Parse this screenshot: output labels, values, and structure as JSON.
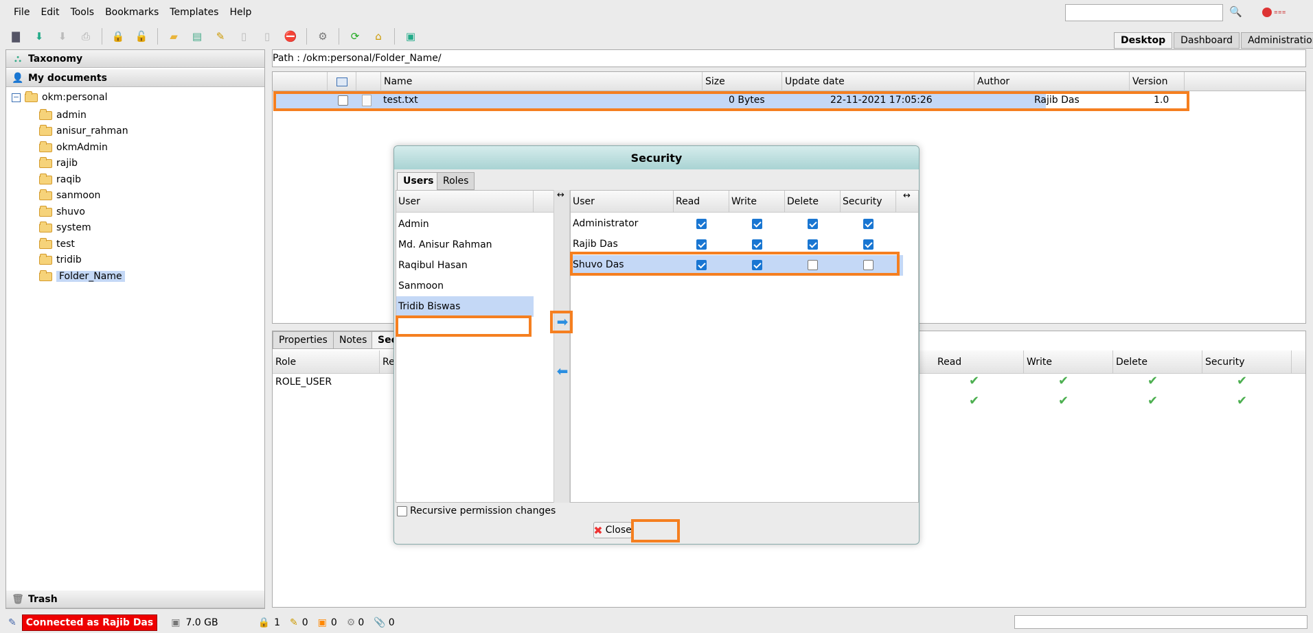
{
  "menu": [
    "File",
    "Edit",
    "Tools",
    "Bookmarks",
    "Templates",
    "Help"
  ],
  "view_tabs": [
    "Desktop",
    "Dashboard",
    "Administration"
  ],
  "left_panel": {
    "taxonomy": "Taxonomy",
    "my_documents": "My documents",
    "trash": "Trash",
    "root": "okm:personal",
    "folders": [
      "admin",
      "anisur_rahman",
      "okmAdmin",
      "rajib",
      "raqib",
      "sanmoon",
      "shuvo",
      "system",
      "test",
      "tridib",
      "Folder_Name"
    ]
  },
  "path": "Path : /okm:personal/Folder_Name/",
  "doc_grid": {
    "headers": [
      "Name",
      "Size",
      "Update date",
      "Author",
      "Version"
    ],
    "rows": [
      {
        "name": "test.txt",
        "size": "0 Bytes",
        "date": "22-11-2021 17:05:26",
        "author": "Rajib Das",
        "version": "1.0"
      }
    ]
  },
  "bottom_panel": {
    "tabs": [
      "Properties",
      "Notes",
      "Sec"
    ],
    "headers": [
      "Role",
      "Re",
      "Read",
      "Write",
      "Delete",
      "Security"
    ],
    "rows": [
      "ROLE_USER"
    ]
  },
  "dialog": {
    "title": "Security",
    "tabs": [
      "Users",
      "Roles"
    ],
    "left_header": "User",
    "users": [
      "Admin",
      "Md. Anisur Rahman",
      "Raqibul Hasan",
      "Sanmoon",
      "Tridib Biswas"
    ],
    "right_headers": [
      "User",
      "Read",
      "Write",
      "Delete",
      "Security"
    ],
    "grants": [
      {
        "name": "Administrator",
        "read": true,
        "write": true,
        "delete": true,
        "security": true
      },
      {
        "name": "Rajib Das",
        "read": true,
        "write": true,
        "delete": true,
        "security": true
      },
      {
        "name": "Shuvo Das",
        "read": true,
        "write": true,
        "delete": false,
        "security": false
      }
    ],
    "recursive_label": "Recursive permission changes",
    "close_label": "Close"
  },
  "status": {
    "connected": "Connected as Rajib Das",
    "disk": "7.0 GB",
    "counters": [
      "1",
      "0",
      "0",
      "0",
      "0"
    ]
  },
  "colors": {
    "highlight": "#f57f20",
    "selection": "#c4d8f6",
    "connected_bg": "#ee0000"
  }
}
